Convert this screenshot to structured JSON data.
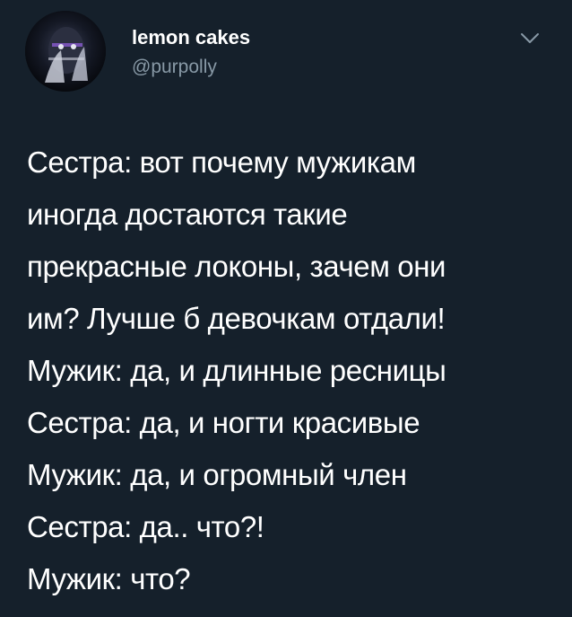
{
  "tweet": {
    "display_name": "lemon cakes",
    "handle": "@purpolly",
    "avatar_icon": "avatar-photo",
    "menu_icon": "chevron-down-icon",
    "lines": [
      "Сестра: вот почему мужикам",
      "иногда достаются такие",
      "прекрасные локоны, зачем они",
      "им? Лучше б девочкам отдали!",
      "Мужик: да, и длинные ресницы",
      "Сестра: да, и ногти красивые",
      "Мужик: да, и огромный член",
      "Сестра: да.. что?!",
      "Мужик: что?"
    ]
  },
  "colors": {
    "background": "#15202b",
    "text_primary": "#ffffff",
    "text_secondary": "#8899a6"
  }
}
